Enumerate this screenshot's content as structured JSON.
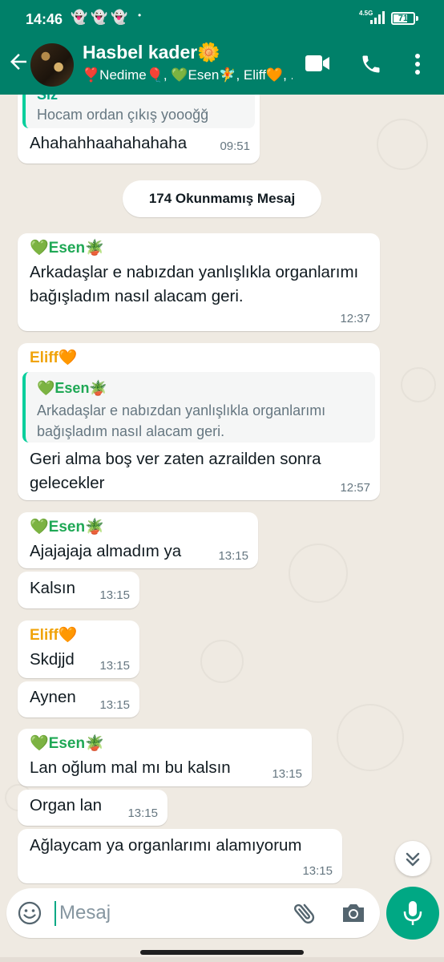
{
  "status_bar": {
    "time": "14:46",
    "notification_icons": "👻👻👻",
    "dot": "•",
    "network": "4.5G",
    "battery": "71",
    "battery_level": 0.71
  },
  "header": {
    "title": "Hasbel kader🌼",
    "subtitle": "❣️Nedime🎈, 💚Esen🧚, Eliff🧡, ...",
    "icons": [
      "back-arrow-icon",
      "video-call-icon",
      "voice-call-icon",
      "more-options-icon"
    ]
  },
  "chat": {
    "top_message": {
      "quote_sender": "Siz",
      "quote_text": "Hocam ordan çıkış yoooğğ",
      "text": "Ahahahhaahahahaha",
      "time": "09:51"
    },
    "unread_banner": "174 Okunmamış Mesaj",
    "messages": [
      {
        "sender": "💚Esen🪴",
        "text": "Arkadaşlar e nabızdan yanlışlıkla organlarımı bağışladım nasıl alacam geri.",
        "time": "12:37"
      },
      {
        "sender": "Eliff🧡",
        "quote_sender": "💚Esen🪴",
        "quote_text": "Arkadaşlar e nabızdan yanlışlıkla organlarımı bağışladım nasıl alacam geri.",
        "text": "Geri alma boş ver zaten azrailden sonra gelecekler",
        "time": "12:57"
      },
      {
        "sender": "💚Esen🪴",
        "text": "Ajajajaja almadım ya",
        "time": "13:15"
      },
      {
        "text": "Kalsın",
        "time": "13:15"
      },
      {
        "sender": "Eliff🧡",
        "text": "Skdjjd",
        "time": "13:15"
      },
      {
        "text": "Aynen",
        "time": "13:15"
      },
      {
        "sender": "💚Esen🪴",
        "text": "Lan oğlum mal mı bu kalsın",
        "time": "13:15"
      },
      {
        "text": "Organ lan",
        "time": "13:15"
      },
      {
        "text": "Ağlaycam ya organlarımı alamıyorum",
        "time": "13:15"
      }
    ]
  },
  "composer": {
    "placeholder": "Mesaj",
    "icons": [
      "emoji-icon",
      "attach-icon",
      "camera-icon",
      "mic-icon"
    ]
  },
  "colors": {
    "header_bg": "#008069",
    "chat_bg": "#efeae2",
    "accent": "#00a884",
    "esen_name": "#1fa855",
    "eliff_name": "#f0a30a",
    "timestamp": "#667781"
  }
}
